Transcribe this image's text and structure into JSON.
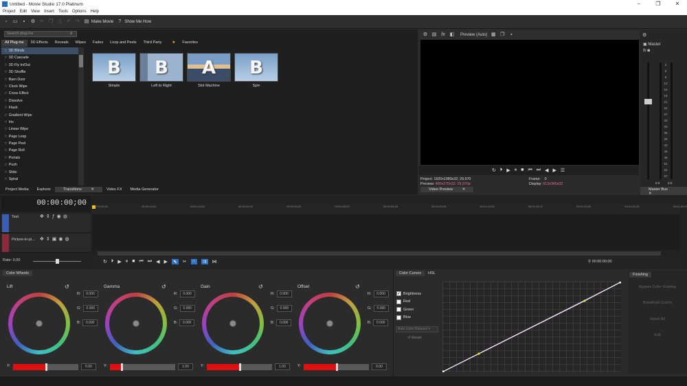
{
  "window": {
    "title": "Untitled - Movie Studio 17.0 Platinum",
    "min": "–",
    "max": "❐",
    "close": "✕"
  },
  "menu": [
    "Project",
    "Edit",
    "View",
    "Insert",
    "Tools",
    "Options",
    "Help"
  ],
  "toolbar": {
    "make_movie": "Make Movie",
    "show_me_how": "Show Me How"
  },
  "plugins": {
    "search_placeholder": "Search plug-ins",
    "tabs": [
      "All Plug-ins",
      "3D Effects",
      "Reveals",
      "Wipes",
      "Fades",
      "Loop and Peels",
      "Third Party",
      "Favorites"
    ],
    "items": [
      "3D Blinds",
      "3D Cascade",
      "3D Fly In/Out",
      "3D Shuffle",
      "Barn Door",
      "Clock Wipe",
      "Cross Effect",
      "Dissolve",
      "Flash",
      "Gradient Wipe",
      "Iris",
      "Linear Wipe",
      "Page Loop",
      "Page Peel",
      "Page Roll",
      "Portals",
      "Push",
      "Slide",
      "Spiral"
    ]
  },
  "presets": [
    {
      "label": "Simple",
      "glyph": "B"
    },
    {
      "label": "Left to Right",
      "glyph": "B"
    },
    {
      "label": "Slot Machine",
      "glyph": "A"
    },
    {
      "label": "Spin",
      "glyph": "B"
    }
  ],
  "dock_tabs": [
    "Project Media",
    "Explorer",
    "Transitions",
    "Video FX",
    "Media Generator"
  ],
  "preview": {
    "mode": "Preview (Auto)",
    "tab": "Video Preview",
    "project_label": "Project:",
    "project_val": "1920x1080x32; 29,970",
    "preview_label": "Preview:",
    "preview_val": "480x270x32; 29,970p",
    "frame_label": "Frame:",
    "frame_val": "0",
    "display_label": "Display:",
    "display_val": "613x345x32"
  },
  "master": {
    "label": "Master",
    "tab": "Master Bus",
    "scale": [
      "3",
      "6",
      "9",
      "12",
      "15",
      "18",
      "21",
      "24",
      "27",
      "30",
      "33",
      "36",
      "39",
      "42",
      "45",
      "48",
      "51",
      "54",
      "57"
    ],
    "left_val": "0.0",
    "right_val": "0.0"
  },
  "timeline": {
    "timecode": "00:00:00;00",
    "rate": "Rate: 0,00",
    "ruler": [
      "00:00:00;00",
      "00:00:10;00",
      "00:00:19;29",
      "00:00:29;29",
      "00:00:39;29",
      "00:00:49;29",
      "00:00:59;28",
      "00:01:09;28",
      "00:01:19;28",
      "00:01:29;29",
      "00:01:39;29",
      "00:01:49;29",
      "00:01:59;29"
    ],
    "tracks": [
      "Text",
      "Picture-in-pi..."
    ],
    "cursor_time": "00:00:00;00"
  },
  "color_wheels": {
    "tab": "Color Wheels",
    "wheels": [
      {
        "name": "Lift",
        "r": "0.000",
        "g": "0.000",
        "b": "0.000",
        "y": "0.00",
        "y_level": 0.5
      },
      {
        "name": "Gamma",
        "r": "0.000",
        "g": "0.000",
        "b": "0.000",
        "y": "1.00",
        "y_level": 0.18
      },
      {
        "name": "Gain",
        "r": "0.000",
        "g": "0.000",
        "b": "0.000",
        "y": "1.00",
        "y_level": 0.5
      },
      {
        "name": "Offset",
        "r": "0.000",
        "g": "0.000",
        "b": "0.000",
        "y": "0.00",
        "y_level": 0.5
      }
    ],
    "r": "R:",
    "g": "G:",
    "b": "B:",
    "ylabel": "Y:"
  },
  "curves": {
    "tabs": [
      "Color Curves",
      "HSL"
    ],
    "channels": [
      {
        "name": "Brightness",
        "checked": true
      },
      {
        "name": "Red",
        "checked": false
      },
      {
        "name": "Green",
        "checked": false
      },
      {
        "name": "Blue",
        "checked": false
      }
    ],
    "auto_balance": "Auto Color Balance",
    "reset": "Reset"
  },
  "finishing": {
    "tab": "Finishing",
    "buttons": [
      "Bypass Color Grading",
      "Broadcast Colors",
      "Reset All",
      "Exit"
    ]
  }
}
